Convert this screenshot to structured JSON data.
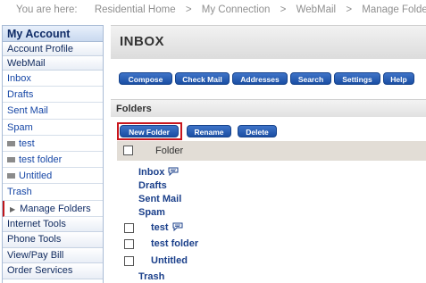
{
  "breadcrumb": {
    "prefix": "You are here:",
    "items": [
      "Residential Home",
      "My Connection",
      "WebMail",
      "Manage Folders"
    ],
    "separator": ">"
  },
  "sidebar": {
    "title": "My Account",
    "sections": [
      {
        "label": "Account Profile"
      },
      {
        "label": "WebMail"
      }
    ],
    "items": [
      {
        "label": "Inbox"
      },
      {
        "label": "Drafts"
      },
      {
        "label": "Sent Mail"
      },
      {
        "label": "Spam"
      },
      {
        "label": "test",
        "icon": "folder-icon"
      },
      {
        "label": "test folder",
        "icon": "folder-icon"
      },
      {
        "label": "Untitled",
        "icon": "folder-icon"
      },
      {
        "label": "Trash"
      },
      {
        "label": "Manage Folders",
        "active": true
      }
    ],
    "bottom_sections": [
      {
        "label": "Internet Tools"
      },
      {
        "label": "Phone Tools"
      },
      {
        "label": "View/Pay Bill"
      },
      {
        "label": "Order Services"
      }
    ]
  },
  "main": {
    "title": "INBOX",
    "toolbar": [
      "Compose",
      "Check Mail",
      "Addresses",
      "Search",
      "Settings",
      "Help"
    ],
    "folders_heading": "Folders",
    "folder_actions": [
      "New Folder",
      "Rename",
      "Delete"
    ],
    "table_header": "Folder",
    "folders": [
      {
        "name": "Inbox",
        "checkbox": false,
        "has_icon": true
      },
      {
        "name": "Drafts",
        "checkbox": false
      },
      {
        "name": "Sent Mail",
        "checkbox": false
      },
      {
        "name": "Spam",
        "checkbox": false
      },
      {
        "name": "test",
        "checkbox": true,
        "has_icon": true
      },
      {
        "name": "test folder",
        "checkbox": true
      },
      {
        "name": "Untitled",
        "checkbox": true
      },
      {
        "name": "Trash",
        "checkbox": false
      }
    ]
  },
  "colors": {
    "accent": "#1a4ea3",
    "highlight_outline": "#c8161d",
    "link": "#1a3f8a"
  }
}
